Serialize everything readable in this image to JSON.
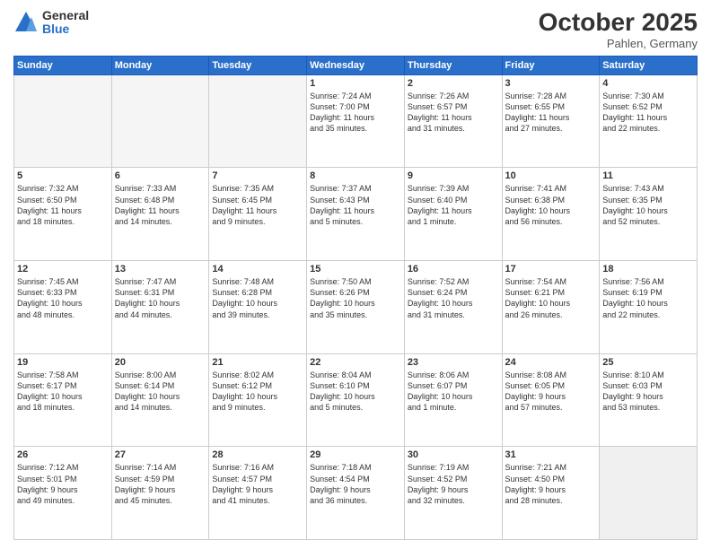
{
  "logo": {
    "general": "General",
    "blue": "Blue"
  },
  "header": {
    "month": "October 2025",
    "location": "Pahlen, Germany"
  },
  "weekdays": [
    "Sunday",
    "Monday",
    "Tuesday",
    "Wednesday",
    "Thursday",
    "Friday",
    "Saturday"
  ],
  "weeks": [
    [
      {
        "day": "",
        "info": ""
      },
      {
        "day": "",
        "info": ""
      },
      {
        "day": "",
        "info": ""
      },
      {
        "day": "1",
        "info": "Sunrise: 7:24 AM\nSunset: 7:00 PM\nDaylight: 11 hours\nand 35 minutes."
      },
      {
        "day": "2",
        "info": "Sunrise: 7:26 AM\nSunset: 6:57 PM\nDaylight: 11 hours\nand 31 minutes."
      },
      {
        "day": "3",
        "info": "Sunrise: 7:28 AM\nSunset: 6:55 PM\nDaylight: 11 hours\nand 27 minutes."
      },
      {
        "day": "4",
        "info": "Sunrise: 7:30 AM\nSunset: 6:52 PM\nDaylight: 11 hours\nand 22 minutes."
      }
    ],
    [
      {
        "day": "5",
        "info": "Sunrise: 7:32 AM\nSunset: 6:50 PM\nDaylight: 11 hours\nand 18 minutes."
      },
      {
        "day": "6",
        "info": "Sunrise: 7:33 AM\nSunset: 6:48 PM\nDaylight: 11 hours\nand 14 minutes."
      },
      {
        "day": "7",
        "info": "Sunrise: 7:35 AM\nSunset: 6:45 PM\nDaylight: 11 hours\nand 9 minutes."
      },
      {
        "day": "8",
        "info": "Sunrise: 7:37 AM\nSunset: 6:43 PM\nDaylight: 11 hours\nand 5 minutes."
      },
      {
        "day": "9",
        "info": "Sunrise: 7:39 AM\nSunset: 6:40 PM\nDaylight: 11 hours\nand 1 minute."
      },
      {
        "day": "10",
        "info": "Sunrise: 7:41 AM\nSunset: 6:38 PM\nDaylight: 10 hours\nand 56 minutes."
      },
      {
        "day": "11",
        "info": "Sunrise: 7:43 AM\nSunset: 6:35 PM\nDaylight: 10 hours\nand 52 minutes."
      }
    ],
    [
      {
        "day": "12",
        "info": "Sunrise: 7:45 AM\nSunset: 6:33 PM\nDaylight: 10 hours\nand 48 minutes."
      },
      {
        "day": "13",
        "info": "Sunrise: 7:47 AM\nSunset: 6:31 PM\nDaylight: 10 hours\nand 44 minutes."
      },
      {
        "day": "14",
        "info": "Sunrise: 7:48 AM\nSunset: 6:28 PM\nDaylight: 10 hours\nand 39 minutes."
      },
      {
        "day": "15",
        "info": "Sunrise: 7:50 AM\nSunset: 6:26 PM\nDaylight: 10 hours\nand 35 minutes."
      },
      {
        "day": "16",
        "info": "Sunrise: 7:52 AM\nSunset: 6:24 PM\nDaylight: 10 hours\nand 31 minutes."
      },
      {
        "day": "17",
        "info": "Sunrise: 7:54 AM\nSunset: 6:21 PM\nDaylight: 10 hours\nand 26 minutes."
      },
      {
        "day": "18",
        "info": "Sunrise: 7:56 AM\nSunset: 6:19 PM\nDaylight: 10 hours\nand 22 minutes."
      }
    ],
    [
      {
        "day": "19",
        "info": "Sunrise: 7:58 AM\nSunset: 6:17 PM\nDaylight: 10 hours\nand 18 minutes."
      },
      {
        "day": "20",
        "info": "Sunrise: 8:00 AM\nSunset: 6:14 PM\nDaylight: 10 hours\nand 14 minutes."
      },
      {
        "day": "21",
        "info": "Sunrise: 8:02 AM\nSunset: 6:12 PM\nDaylight: 10 hours\nand 9 minutes."
      },
      {
        "day": "22",
        "info": "Sunrise: 8:04 AM\nSunset: 6:10 PM\nDaylight: 10 hours\nand 5 minutes."
      },
      {
        "day": "23",
        "info": "Sunrise: 8:06 AM\nSunset: 6:07 PM\nDaylight: 10 hours\nand 1 minute."
      },
      {
        "day": "24",
        "info": "Sunrise: 8:08 AM\nSunset: 6:05 PM\nDaylight: 9 hours\nand 57 minutes."
      },
      {
        "day": "25",
        "info": "Sunrise: 8:10 AM\nSunset: 6:03 PM\nDaylight: 9 hours\nand 53 minutes."
      }
    ],
    [
      {
        "day": "26",
        "info": "Sunrise: 7:12 AM\nSunset: 5:01 PM\nDaylight: 9 hours\nand 49 minutes."
      },
      {
        "day": "27",
        "info": "Sunrise: 7:14 AM\nSunset: 4:59 PM\nDaylight: 9 hours\nand 45 minutes."
      },
      {
        "day": "28",
        "info": "Sunrise: 7:16 AM\nSunset: 4:57 PM\nDaylight: 9 hours\nand 41 minutes."
      },
      {
        "day": "29",
        "info": "Sunrise: 7:18 AM\nSunset: 4:54 PM\nDaylight: 9 hours\nand 36 minutes."
      },
      {
        "day": "30",
        "info": "Sunrise: 7:19 AM\nSunset: 4:52 PM\nDaylight: 9 hours\nand 32 minutes."
      },
      {
        "day": "31",
        "info": "Sunrise: 7:21 AM\nSunset: 4:50 PM\nDaylight: 9 hours\nand 28 minutes."
      },
      {
        "day": "",
        "info": ""
      }
    ]
  ]
}
